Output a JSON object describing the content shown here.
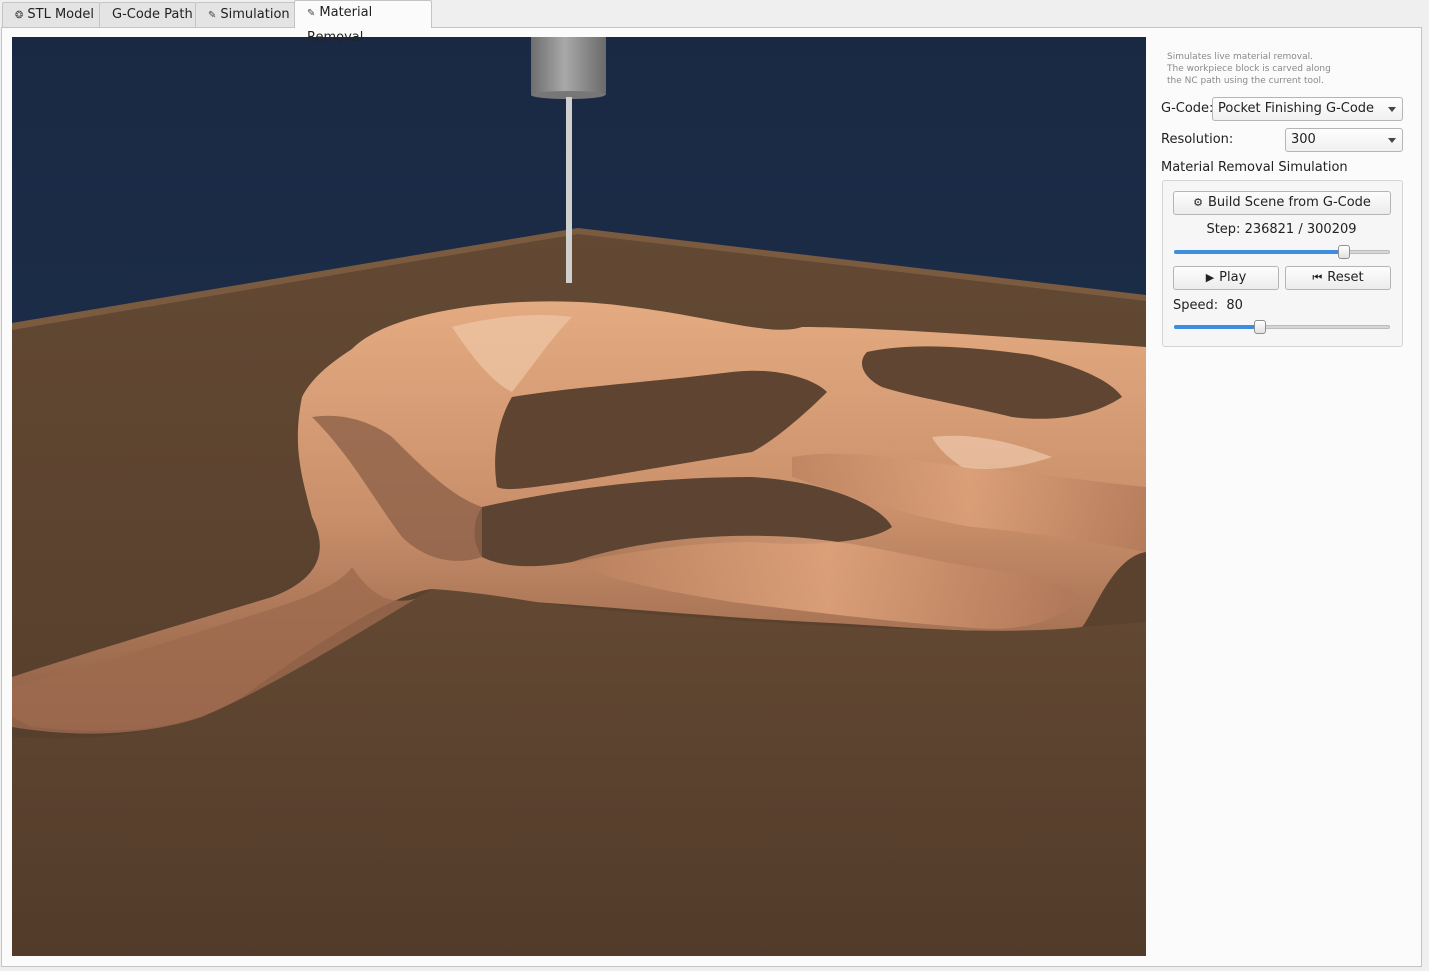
{
  "tabs": [
    {
      "label": "STL Model",
      "icon": "cube-icon",
      "glyph": "❂"
    },
    {
      "label": "G-Code Path",
      "icon": "",
      "glyph": ""
    },
    {
      "label": "Simulation",
      "icon": "wrench-icon",
      "glyph": "✎"
    },
    {
      "label": "Material Removal",
      "icon": "chisel-icon",
      "glyph": "✎"
    }
  ],
  "active_tab": 3,
  "panel": {
    "description": [
      "Simulates live material removal.",
      "The workpiece block is carved along",
      "the NC path using the current tool."
    ],
    "gcode_label": "G-Code:",
    "gcode_value": "Pocket Finishing G-Code",
    "resolution_label": "Resolution:",
    "resolution_value": "300",
    "group_title": "Material Removal Simulation",
    "build_label": "Build Scene from G-Code",
    "build_icon_glyph": "⚙",
    "step_label": "Step:",
    "step_current": "236821",
    "step_sep": "/",
    "step_total": "300209",
    "step_fraction": 0.7888,
    "play_label": "Play",
    "play_glyph": "▶",
    "reset_label": "Reset",
    "reset_glyph": "⏮",
    "speed_label": "Speed:",
    "speed_value": "80",
    "speed_fraction": 0.4
  },
  "colors": {
    "background": "#1a2943",
    "stock_top": "#5b4331",
    "stock_side": "#4a3525",
    "carved": "#c98f6a",
    "carved_shadow": "#7a5340",
    "tool": "#8e8e8e",
    "slider_fill": "#3d8ee0"
  }
}
